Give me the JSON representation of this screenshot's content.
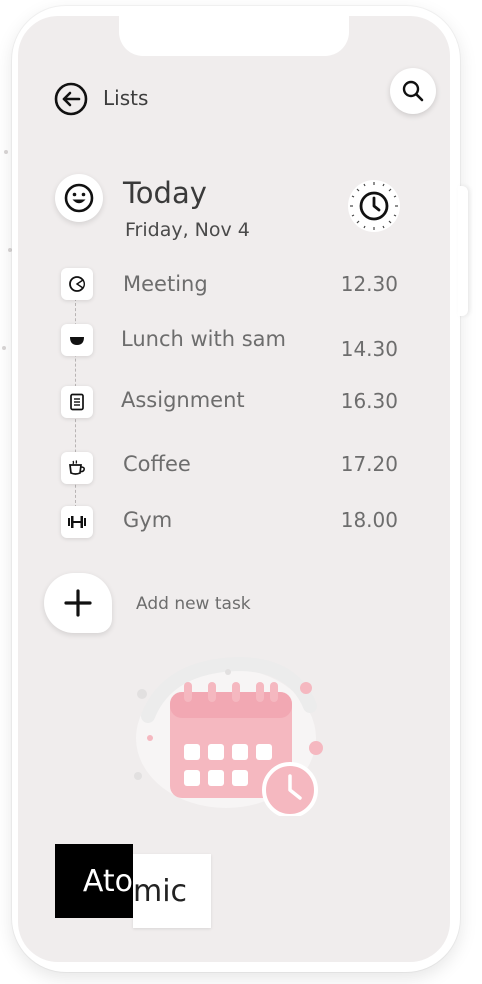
{
  "header": {
    "back_icon": "arrow-left-circle-icon",
    "lists_label": "Lists",
    "search_icon": "search-icon"
  },
  "day": {
    "mood_icon": "smiley-icon",
    "title": "Today",
    "date": "Friday, Nov 4",
    "clock_icon": "clock-icon"
  },
  "tasks": [
    {
      "icon": "meeting-icon",
      "name": "Meeting",
      "time": "12.30"
    },
    {
      "icon": "lunch-bowl-icon",
      "name": "Lunch with sam",
      "time": "14.30"
    },
    {
      "icon": "document-icon",
      "name": "Assignment",
      "time": "16.30"
    },
    {
      "icon": "coffee-cup-icon",
      "name": "Coffee",
      "time": "17.20"
    },
    {
      "icon": "dumbbell-icon",
      "name": "Gym",
      "time": "18.00"
    }
  ],
  "add_task": {
    "icon": "plus-icon",
    "label": "Add new task"
  },
  "illustration": {
    "icon": "calendar-clock-illustration",
    "accent_color": "#f5b8c0"
  },
  "logo": {
    "left": "Ato",
    "right": "mic"
  },
  "colors": {
    "screen_bg": "#f0eded",
    "text": "#6d6d6d",
    "accent": "#f5b8c0"
  }
}
